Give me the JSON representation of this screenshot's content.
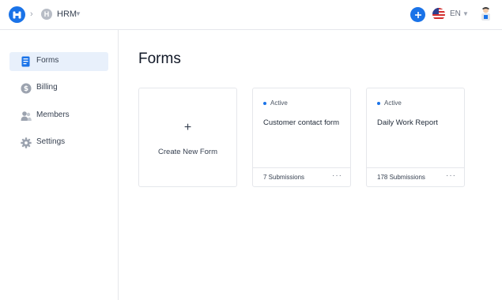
{
  "header": {
    "workspace_initial": "H",
    "workspace_name": "HRM",
    "language": "EN",
    "icons": [
      "app-logo-icon",
      "chevron-right-icon",
      "chevron-down-icon",
      "plus-icon",
      "us-flag-icon",
      "user-avatar-icon"
    ]
  },
  "sidebar": {
    "items": [
      {
        "label": "Forms",
        "icon": "forms-icon",
        "active": true
      },
      {
        "label": "Billing",
        "icon": "dollar-icon",
        "active": false
      },
      {
        "label": "Members",
        "icon": "members-icon",
        "active": false
      },
      {
        "label": "Settings",
        "icon": "gear-icon",
        "active": false
      }
    ]
  },
  "main": {
    "title": "Forms",
    "create_card": {
      "plus": "+",
      "label": "Create New Form"
    },
    "forms": [
      {
        "status": "Active",
        "name": "Customer contact form",
        "submissions": "7 Submissions",
        "more": "···"
      },
      {
        "status": "Active",
        "name": "Daily Work Report",
        "submissions": "178 Submissions",
        "more": "···"
      }
    ]
  },
  "colors": {
    "accent": "#1a73e8",
    "active_nav_bg": "#e8f0fb",
    "border": "#e5e7eb"
  }
}
